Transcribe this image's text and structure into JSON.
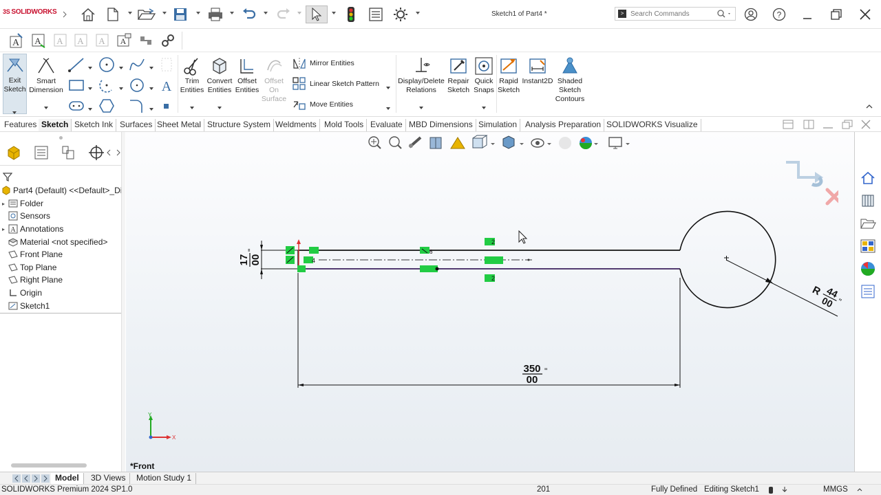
{
  "app": {
    "brand": "SOLIDWORKS",
    "document_title": "Sketch1 of Part4 *"
  },
  "search": {
    "placeholder": "Search Commands"
  },
  "command_manager": {
    "exit_sketch": "Exit Sketch",
    "smart_dimension": "Smart Dimension",
    "trim_entities": "Trim Entities",
    "convert_entities": "Convert Entities",
    "offset_entities": "Offset Entities",
    "offset_on_surface": "Offset On Surface",
    "mirror_entities": "Mirror Entities",
    "linear_sketch_pattern": "Linear Sketch Pattern",
    "move_entities": "Move Entities",
    "display_delete_relations": "Display/Delete Relations",
    "repair_sketch": "Repair Sketch",
    "quick_snaps": "Quick Snaps",
    "rapid_sketch": "Rapid Sketch",
    "instant2d": "Instant2D",
    "shaded_sketch_contours": "Shaded Sketch Contours"
  },
  "tabs": [
    {
      "label": "Features"
    },
    {
      "label": "Sketch"
    },
    {
      "label": "Sketch Ink"
    },
    {
      "label": "Surfaces"
    },
    {
      "label": "Sheet Metal"
    },
    {
      "label": "Structure System"
    },
    {
      "label": "Weldments"
    },
    {
      "label": "Mold Tools"
    },
    {
      "label": "Evaluate"
    },
    {
      "label": "MBD Dimensions"
    },
    {
      "label": "Simulation"
    },
    {
      "label": "Analysis Preparation"
    },
    {
      "label": "SOLIDWORKS Visualize"
    }
  ],
  "active_tab": "Sketch",
  "feature_tree": {
    "root": "Part4 (Default) <<Default>_Disp",
    "items": [
      {
        "label": "Folder",
        "expandable": true
      },
      {
        "label": "Sensors",
        "expandable": false
      },
      {
        "label": "Annotations",
        "expandable": true
      },
      {
        "label": "Material <not specified>",
        "expandable": false
      },
      {
        "label": "Front Plane",
        "expandable": false
      },
      {
        "label": "Top Plane",
        "expandable": false
      },
      {
        "label": "Right Plane",
        "expandable": false
      },
      {
        "label": "Origin",
        "expandable": false
      },
      {
        "label": "Sketch1",
        "expandable": false
      }
    ]
  },
  "sketch": {
    "dim_width_top": "17",
    "dim_width_bottom": "00",
    "dim_length_top": "350",
    "dim_length_bottom": "00",
    "dim_radius_prefix": "R",
    "dim_radius_top": "44",
    "dim_radius_bottom": "00",
    "inch_mark": "\"",
    "relation_2": "2",
    "relation_4": "4",
    "relation_6": "6"
  },
  "triad": {
    "x": "X",
    "y": "Y"
  },
  "view": {
    "label": "*Front"
  },
  "bottom_tabs": [
    {
      "label": "Model",
      "active": true
    },
    {
      "label": "3D Views",
      "active": false
    },
    {
      "label": "Motion Study 1",
      "active": false
    }
  ],
  "status": {
    "product": "SOLIDWORKS Premium 2024 SP1.0",
    "coordinate": "201",
    "state": "Fully Defined",
    "editing": "Editing Sketch1",
    "units": "MMGS"
  },
  "colors": {
    "accent_red": "#c8102e",
    "relation_green": "#22cc44",
    "sketch_line": "#111111",
    "selected_line": "#3a1f5c"
  }
}
